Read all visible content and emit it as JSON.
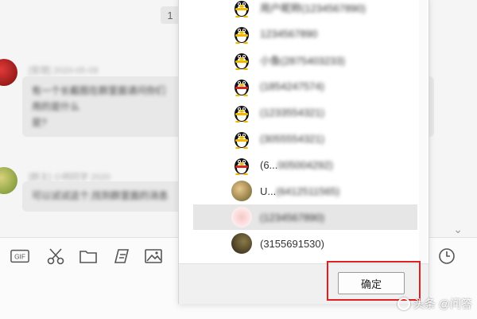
{
  "chat": {
    "unread_badge": "1",
    "messages": [
      {
        "meta": "[管理] 2020-05-09",
        "text_line1": "有一个长截图在群里面请问你们用的是什么",
        "text_line2": "是?"
      },
      {
        "meta": "[群主] 小明同学 2020",
        "text_line1": "可以试试这个,找到群里面的消息"
      }
    ]
  },
  "toolbar": {
    "icons": [
      "gif-icon",
      "scissors-icon",
      "folder-icon",
      "bookmark-icon",
      "image-icon",
      "clock-icon"
    ],
    "gif_label": "GIF"
  },
  "popup": {
    "contacts": [
      {
        "avatar": "penguin",
        "name": "用户昵称(1234567890)",
        "selected": false
      },
      {
        "avatar": "penguin",
        "name": "1234567890",
        "selected": false
      },
      {
        "avatar": "penguin",
        "name": "小鱼(2875403233)",
        "selected": false
      },
      {
        "avatar": "penguin-red",
        "name": "(1854247574)",
        "selected": false
      },
      {
        "avatar": "penguin",
        "name": "(1233554321)",
        "selected": false
      },
      {
        "avatar": "penguin",
        "name": "(3055554321)",
        "selected": false
      },
      {
        "avatar": "penguin-red",
        "name": "(6...",
        "name_blur": "005004292)",
        "selected": false
      },
      {
        "avatar": "photo",
        "name": "U...",
        "name_blur": "(6412511565)",
        "selected": false
      },
      {
        "avatar": "flower",
        "name": "(1234567890)",
        "selected": true
      },
      {
        "avatar": "dark-photo",
        "name": "(3155691530)",
        "selected": false
      }
    ],
    "confirm_label": "确定"
  },
  "watermark": {
    "text": "头条 @问答"
  },
  "colors": {
    "highlight_border": "#e02020",
    "selected_row": "#e6e6e6"
  }
}
